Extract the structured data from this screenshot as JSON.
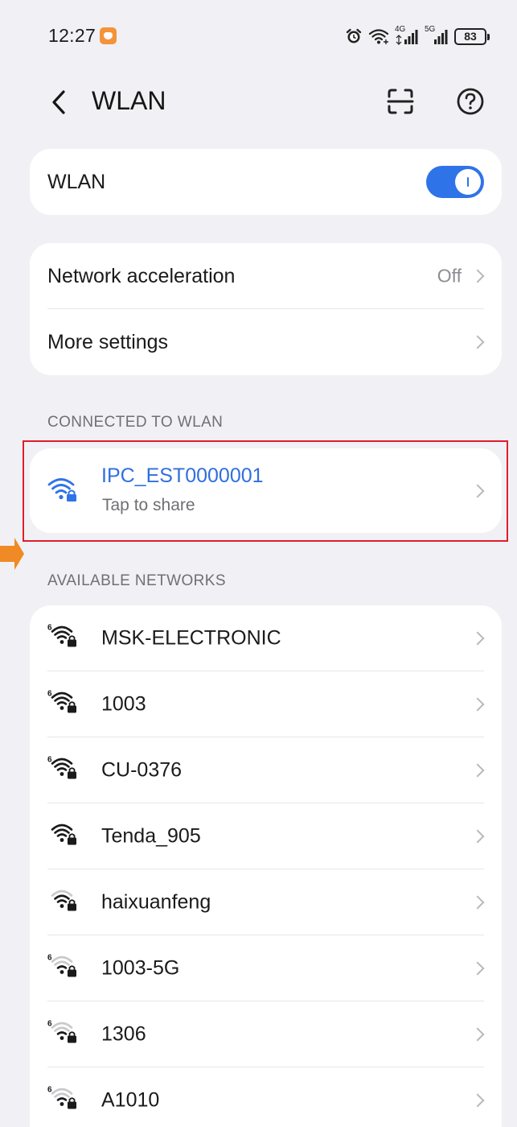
{
  "status_bar": {
    "time": "12:27",
    "battery": "83",
    "icons": [
      "alarm-icon",
      "wifi-status-icon",
      "4g-signal-icon",
      "5g-signal-icon",
      "battery-icon"
    ],
    "signal_1_label": "4G",
    "signal_2_label": "5G"
  },
  "header": {
    "title": "WLAN",
    "back_icon": "chevron-left-icon",
    "scan_icon": "scan-icon",
    "help_icon": "help-icon"
  },
  "wlan_card": {
    "label": "WLAN",
    "toggle_on": true
  },
  "settings_card": {
    "items": [
      {
        "label": "Network acceleration",
        "value": "Off"
      },
      {
        "label": "More settings",
        "value": ""
      }
    ]
  },
  "connected": {
    "section_title": "CONNECTED TO WLAN",
    "ssid": "IPC_EST0000001",
    "subtitle": "Tap to share"
  },
  "available": {
    "section_title": "AVAILABLE NETWORKS",
    "networks": [
      {
        "name": "MSK-ELECTRONIC",
        "wifi6": true,
        "signal": 4
      },
      {
        "name": "1003",
        "wifi6": true,
        "signal": 4
      },
      {
        "name": "CU-0376",
        "wifi6": true,
        "signal": 4
      },
      {
        "name": "Tenda_905",
        "wifi6": false,
        "signal": 4
      },
      {
        "name": "haixuanfeng",
        "wifi6": false,
        "signal": 3
      },
      {
        "name": "1003-5G",
        "wifi6": true,
        "signal": 2
      },
      {
        "name": "1306",
        "wifi6": true,
        "signal": 2
      },
      {
        "name": "A1010",
        "wifi6": true,
        "signal": 2
      }
    ]
  },
  "colors": {
    "accent": "#2f73e8",
    "connected_text": "#2f6fde",
    "highlight": "#e01c2c",
    "background": "#f1f1f5",
    "marker": "#f08a24"
  }
}
